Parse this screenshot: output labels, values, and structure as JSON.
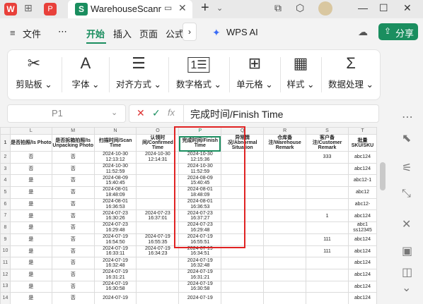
{
  "titlebar": {
    "tab_title": "WarehouseScann",
    "pdf_glyph": "P",
    "wps_glyph": "W",
    "sheet_glyph": "S"
  },
  "menu": {
    "file": "文件",
    "more": "⋯",
    "start": "开始",
    "insert": "插入",
    "page": "页面",
    "formula": "公式",
    "wps_ai": "WPS AI",
    "share": "分享"
  },
  "ribbon": [
    {
      "label": "剪贴板",
      "icon": "✂"
    },
    {
      "label": "字体",
      "icon": "A"
    },
    {
      "label": "对齐方式",
      "icon": "☰"
    },
    {
      "label": "数字格式",
      "icon": "1⃣"
    },
    {
      "label": "单元格",
      "icon": "⊞"
    },
    {
      "label": "样式",
      "icon": "▦"
    },
    {
      "label": "数据处理",
      "icon": "Σ"
    }
  ],
  "formula_bar": {
    "cell_ref": "P1",
    "fx": "fx",
    "content": "完成时间/Finish Time"
  },
  "sheet": {
    "columns": [
      "L",
      "M",
      "N",
      "O",
      "P",
      "Q",
      "R",
      "S",
      "T"
    ],
    "header": [
      "是否拍照/Is Photo",
      "是否拆箱拍照/Is Unpacking Photo",
      "扫描时间/Scan Time",
      "认领时间/Confirmed Time",
      "完成时间/Finish Time",
      "异常情况/Abnormal Situation",
      "仓库备注/Warehouse Remark",
      "客户备注/Customer Remark",
      "批量SKU/SKU"
    ],
    "rows": [
      {
        "n": "2",
        "cells": [
          "否",
          "否",
          "2024-10-30 12:13:12",
          "2024-10-30 12:14:31",
          "2024-10-30 12:15:36",
          "",
          "",
          "333",
          "abc124"
        ]
      },
      {
        "n": "3",
        "cells": [
          "否",
          "否",
          "2024-10-30 11:52:59",
          "",
          "2024-10-30 11:52:59",
          "",
          "",
          "",
          "abc124"
        ]
      },
      {
        "n": "4",
        "cells": [
          "是",
          "否",
          "2024-08-09 15:40:45",
          "",
          "2024-08-09 15:40:45",
          "",
          "",
          "",
          "abc12-1"
        ]
      },
      {
        "n": "5",
        "cells": [
          "是",
          "否",
          "2024-08-01 18:48:09",
          "",
          "2024-08-01 18:48:09",
          "",
          "",
          "",
          "abc12"
        ]
      },
      {
        "n": "6",
        "cells": [
          "是",
          "否",
          "2024-08-01 16:36:53",
          "",
          "2024-08-01 16:36:53",
          "",
          "",
          "",
          "abc12-"
        ]
      },
      {
        "n": "7",
        "cells": [
          "是",
          "否",
          "2024-07-23 16:30:26",
          "2024-07-23 16:37:01",
          "2024-07-23 16:37:27",
          "",
          "",
          "1",
          "abc124"
        ]
      },
      {
        "n": "8",
        "cells": [
          "是",
          "否",
          "2024-07-23 16:29:48",
          "",
          "2024-07-23 16:29:48",
          "",
          "",
          "",
          "abc1 ss12345"
        ]
      },
      {
        "n": "9",
        "cells": [
          "是",
          "否",
          "2024-07-19 16:54:50",
          "2024-07-19 16:55:35",
          "2024-07-19 16:55:51",
          "",
          "",
          "111",
          "abc124"
        ]
      },
      {
        "n": "10",
        "cells": [
          "是",
          "否",
          "2024-07-19 16:33:11",
          "2024-07-19 16:34:23",
          "2024-07-19 16:34:51",
          "",
          "",
          "111",
          "abc124"
        ]
      },
      {
        "n": "11",
        "cells": [
          "是",
          "否",
          "2024-07-19 16:32:48",
          "",
          "2024-07-19 16:32:48",
          "",
          "",
          "",
          "abc124"
        ]
      },
      {
        "n": "12",
        "cells": [
          "是",
          "否",
          "2024-07-19 16:31:21",
          "",
          "2024-07-19 16:31:21",
          "",
          "",
          "",
          "abc124"
        ]
      },
      {
        "n": "13",
        "cells": [
          "是",
          "否",
          "2024-07-19 16:30:58",
          "",
          "2024-07-19 16:30:58",
          "",
          "",
          "",
          "abc124"
        ]
      },
      {
        "n": "14",
        "cells": [
          "是",
          "否",
          "2024-07-19",
          "",
          "2024-07-19",
          "",
          "",
          "",
          "abc124"
        ]
      }
    ]
  }
}
